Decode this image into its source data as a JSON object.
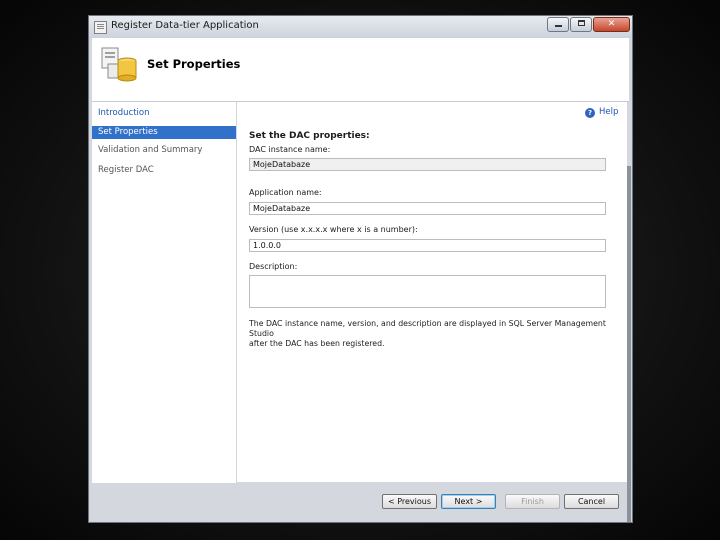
{
  "window": {
    "title": "Register Data-tier Application",
    "controls": {
      "minimize": "",
      "maximize": "",
      "close": "✕"
    }
  },
  "header": {
    "icon": "database-wizard-icon",
    "title": "Set Properties"
  },
  "sidebar": {
    "items": [
      {
        "label": "Introduction",
        "state": "done"
      },
      {
        "label": "Set Properties",
        "state": "active"
      },
      {
        "label": "Validation and Summary",
        "state": "pending"
      },
      {
        "label": "Register DAC",
        "state": "pending"
      }
    ]
  },
  "main": {
    "help_label": "Help",
    "help_icon": "?",
    "section_title": "Set the DAC properties:",
    "fields": {
      "dac_instance": {
        "label": "DAC instance name:",
        "value": "MojeDatabaze"
      },
      "application": {
        "label": "Application name:",
        "value": "MojeDatabaze"
      },
      "version": {
        "label": "Version (use x.x.x.x where x is a number):",
        "value": "1.0.0.0"
      },
      "description": {
        "label": "Description:",
        "value": ""
      }
    },
    "note_line1": "The DAC instance name, version, and description are displayed in SQL Server Management Studio",
    "note_line2": "after the DAC has been registered."
  },
  "footer": {
    "previous": "< Previous",
    "next": "Next >",
    "finish": "Finish",
    "cancel": "Cancel"
  }
}
